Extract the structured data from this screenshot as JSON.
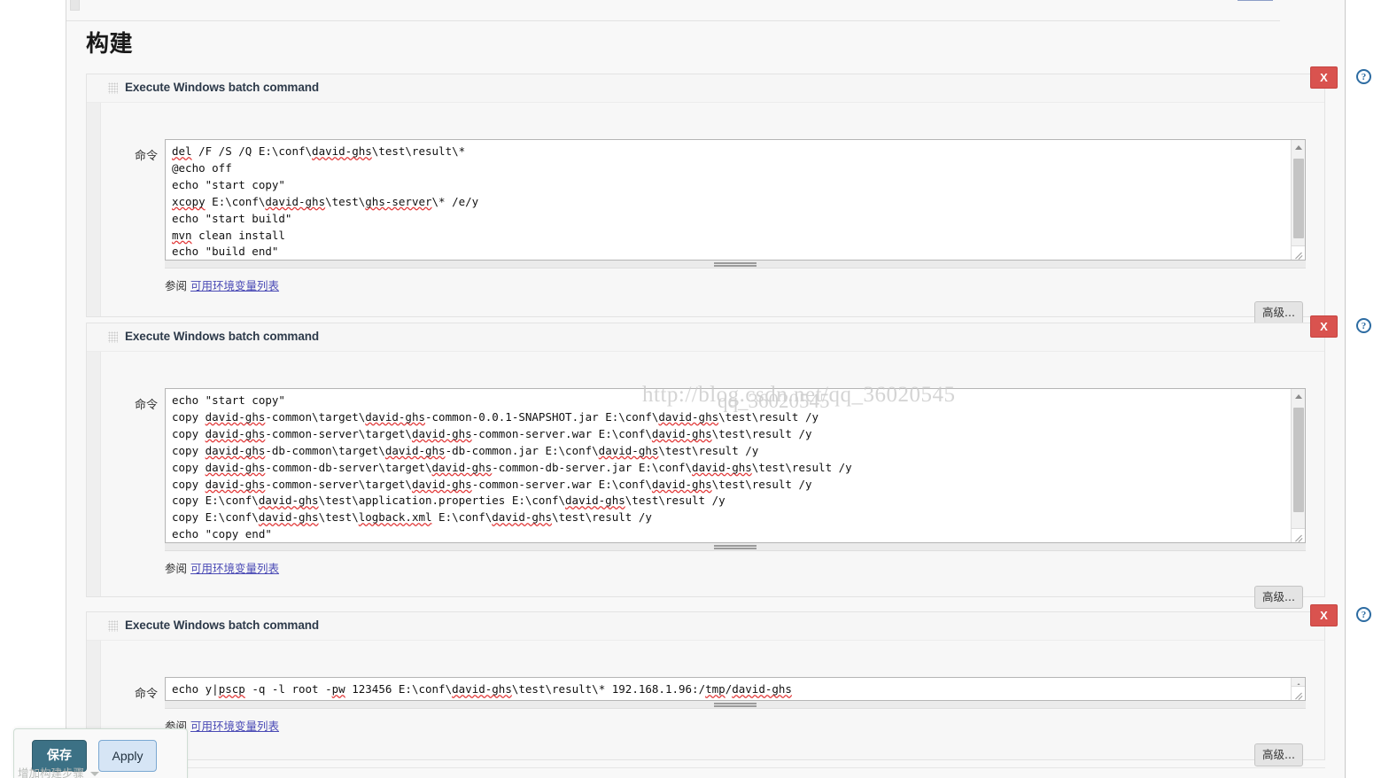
{
  "page": {
    "title": "构建",
    "watermark": "qq_36020545",
    "watermark_url": "http://blog.csdn.net/qq_36020545"
  },
  "common": {
    "command_label": "命令",
    "see_also_prefix": "参阅",
    "see_also_link": "可用环境变量列表",
    "advanced_label": "高级...",
    "delete_label": "X",
    "help_label": "?"
  },
  "build_steps": [
    {
      "title": "Execute Windows batch command",
      "command": "del /F /S /Q E:\\conf\\david-ghs\\test\\result\\*\n@echo off\necho \"start copy\"\nxcopy E:\\conf\\david-ghs\\test\\ghs-server\\* /e/y\necho \"start build\"\nmvn clean install\necho \"build end\""
    },
    {
      "title": "Execute Windows batch command",
      "command": "echo \"start copy\"\ncopy david-ghs-common\\target\\david-ghs-common-0.0.1-SNAPSHOT.jar E:\\conf\\david-ghs\\test\\result /y\ncopy david-ghs-common-server\\target\\david-ghs-common-server.war E:\\conf\\david-ghs\\test\\result /y\ncopy david-ghs-db-common\\target\\david-ghs-db-common.jar E:\\conf\\david-ghs\\test\\result /y\ncopy david-ghs-common-db-server\\target\\david-ghs-common-db-server.jar E:\\conf\\david-ghs\\test\\result /y\ncopy david-ghs-common-server\\target\\david-ghs-common-server.war E:\\conf\\david-ghs\\test\\result /y\ncopy E:\\conf\\david-ghs\\test\\application.properties E:\\conf\\david-ghs\\test\\result /y\ncopy E:\\conf\\david-ghs\\test\\logback.xml E:\\conf\\david-ghs\\test\\result /y\necho \"copy end\""
    },
    {
      "title": "Execute Windows batch command",
      "command": "echo y|pscp -q -l root -pw 123456 E:\\conf\\david-ghs\\test\\result\\* 192.168.1.96:/tmp/david-ghs"
    }
  ],
  "footer": {
    "save_label": "保存",
    "apply_label": "Apply",
    "add_build_step_label": "增加构建步骤"
  },
  "colors": {
    "delete_red": "#d9534f",
    "help_blue": "#2d6ca2",
    "save_teal": "#3c7185",
    "apply_blue": "#d6e5f5",
    "link_purple": "#4a4ab5"
  }
}
